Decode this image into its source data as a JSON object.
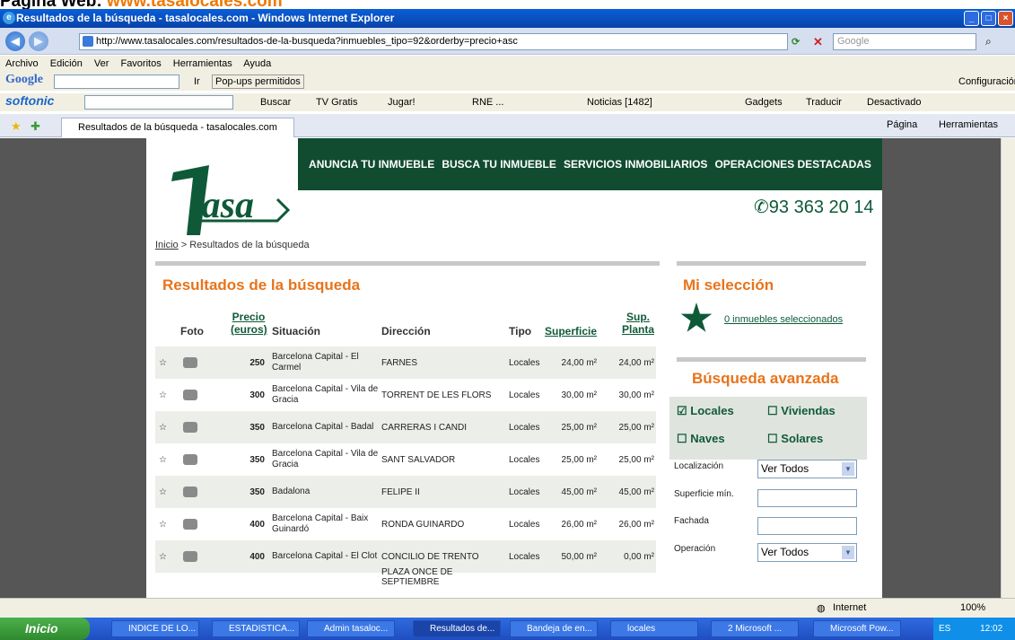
{
  "page_label": {
    "prefix": "Página Web: ",
    "url": "www.tasalocales.com"
  },
  "window": {
    "title": "Resultados de la búsqueda - tasalocales.com - Windows Internet Explorer"
  },
  "address_bar": {
    "url": "http://www.tasalocales.com/resultados-de-la-busqueda?inmuebles_tipo=92&orderby=precio+asc",
    "search_placeholder": "Google"
  },
  "menu": [
    "Archivo",
    "Edición",
    "Ver",
    "Favoritos",
    "Herramientas",
    "Ayuda"
  ],
  "google_bar": {
    "brand": "Google",
    "ir": "Ir",
    "popups": "Pop-ups permitidos",
    "config": "Configuración"
  },
  "softonic_bar": {
    "brand": "softonic",
    "buscar": "Buscar",
    "tv": "TV Gratis",
    "jugar": "Jugar!",
    "rne": "RNE ...",
    "noticias": "Noticias [1482]",
    "gadgets": "Gadgets",
    "traducir": "Traducir",
    "desactivado": "Desactivado"
  },
  "tab": {
    "title": "Resultados de la búsqueda - tasalocales.com",
    "pagina": "Página",
    "herramientas": "Herramientas"
  },
  "site": {
    "logo_text": "tasa",
    "nav": [
      "ANUNCIA TU INMUEBLE",
      "BUSCA TU INMUEBLE",
      "SERVICIOS INMOBILIARIOS",
      "OPERACIONES DESTACADAS"
    ],
    "phone": "93 363 20 14",
    "breadcrumb": {
      "home": "Inicio",
      "sep": " > ",
      "current": "Resultados de la búsqueda"
    },
    "results_title": "Resultados de la búsqueda",
    "headers": {
      "foto": "Foto",
      "precio1": "Precio",
      "precio2": "(euros)",
      "situacion": "Situación",
      "direccion": "Dirección",
      "tipo": "Tipo",
      "superficie": "Superficie",
      "sup1": "Sup.",
      "sup2": "Planta"
    },
    "rows": [
      {
        "precio": "250",
        "situacion": "Barcelona Capital - El Carmel",
        "direccion": "FARNES",
        "tipo": "Locales",
        "superficie": "24,00 m²",
        "planta": "24,00 m²"
      },
      {
        "precio": "300",
        "situacion": "Barcelona Capital - Vila de Gracia",
        "direccion": "TORRENT DE LES FLORS",
        "tipo": "Locales",
        "superficie": "30,00 m²",
        "planta": "30,00 m²"
      },
      {
        "precio": "350",
        "situacion": "Barcelona Capital - Badal",
        "direccion": "CARRERAS I CANDI",
        "tipo": "Locales",
        "superficie": "25,00 m²",
        "planta": "25,00 m²"
      },
      {
        "precio": "350",
        "situacion": "Barcelona Capital - Vila de Gracia",
        "direccion": "SANT SALVADOR",
        "tipo": "Locales",
        "superficie": "25,00 m²",
        "planta": "25,00 m²"
      },
      {
        "precio": "350",
        "situacion": "Badalona",
        "direccion": "FELIPE II",
        "tipo": "Locales",
        "superficie": "45,00 m²",
        "planta": "45,00 m²"
      },
      {
        "precio": "400",
        "situacion": "Barcelona Capital - Baix Guinardó",
        "direccion": "RONDA GUINARDO",
        "tipo": "Locales",
        "superficie": "26,00 m²",
        "planta": "26,00 m²"
      },
      {
        "precio": "400",
        "situacion": "Barcelona Capital - El Clot",
        "direccion": "CONCILIO DE TRENTO",
        "tipo": "Locales",
        "superficie": "50,00 m²",
        "planta": "0,00 m²"
      }
    ],
    "partial_row_dir": "PLAZA ONCE DE SEPTIEMBRE",
    "mi_seleccion": "Mi selección",
    "seleccionados": "0 inmuebles seleccionados",
    "busqueda_avanzada": "Búsqueda avanzada",
    "checks": {
      "locales": "Locales",
      "viviendas": "Viviendas",
      "naves": "Naves",
      "solares": "Solares"
    },
    "filters": {
      "localizacion": "Localización",
      "superficie": "Superficie mín.",
      "fachada": "Fachada",
      "operacion": "Operación",
      "ver_todos": "Ver Todos"
    }
  },
  "status": {
    "zone": "Internet",
    "zoom": "100%"
  },
  "taskbar": {
    "start": "Inicio",
    "tasks": [
      "INDICE DE LO...",
      "ESTADISTICA...",
      "Admin tasaloc...",
      "Resultados de...",
      "Bandeja de en...",
      "locales",
      "2 Microsoft ...",
      "Microsoft Pow..."
    ],
    "lang": "ES",
    "clock": "12:02"
  },
  "colors": {
    "brand_green": "#114c30",
    "accent_orange": "#e8731a"
  }
}
